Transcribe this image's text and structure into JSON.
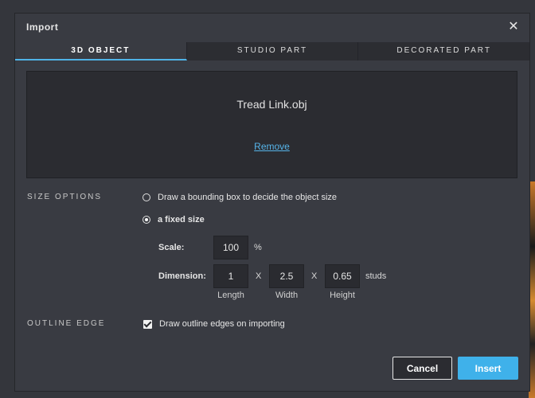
{
  "dialog": {
    "title": "Import",
    "close_icon": "close-icon"
  },
  "tabs": [
    {
      "label": "3D OBJECT",
      "active": true
    },
    {
      "label": "STUDIO PART",
      "active": false
    },
    {
      "label": "DECORATED PART",
      "active": false
    }
  ],
  "dropzone": {
    "filename": "Tread Link.obj",
    "remove_label": "Remove"
  },
  "size_options": {
    "label": "SIZE OPTIONS",
    "option_bounding": "Draw a bounding box to decide the object size",
    "option_fixed": "a fixed size",
    "selected": "fixed"
  },
  "scale": {
    "label": "Scale:",
    "value": "100",
    "unit": "%"
  },
  "dimension": {
    "label": "Dimension:",
    "length": "1",
    "width": "2.5",
    "height": "0.65",
    "separator": "X",
    "unit": "studs",
    "length_label": "Length",
    "width_label": "Width",
    "height_label": "Height"
  },
  "outline": {
    "label": "OUTLINE EDGE",
    "checkbox_label": "Draw outline edges on importing",
    "checked": true
  },
  "buttons": {
    "cancel": "Cancel",
    "insert": "Insert"
  },
  "colors": {
    "accent": "#3fb1ea",
    "link": "#56b5ea",
    "dialog_bg": "#393b42"
  }
}
